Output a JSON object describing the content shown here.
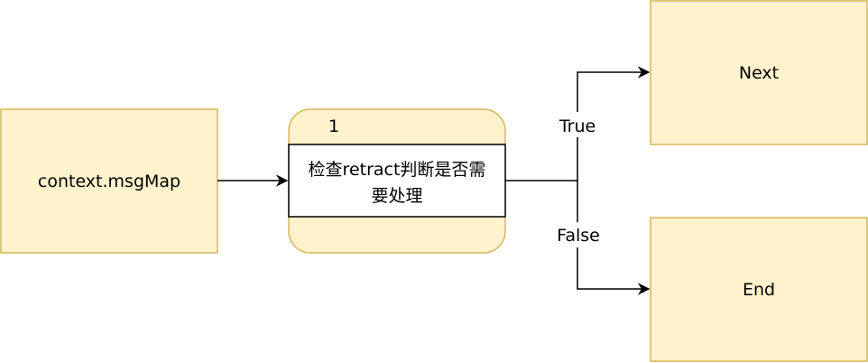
{
  "diagram": {
    "colors": {
      "fill": "#fff2cc",
      "stroke": "#d6b656",
      "line": "#000000",
      "inner_fill": "#ffffff"
    },
    "nodes": {
      "source": {
        "label": "context.msgMap"
      },
      "process": {
        "number": "1",
        "label_line1": "检查retract判断是否需",
        "label_line2": "要处理"
      },
      "next": {
        "label": "Next"
      },
      "end": {
        "label": "End"
      }
    },
    "edges": {
      "true_label": "True",
      "false_label": "False"
    }
  }
}
